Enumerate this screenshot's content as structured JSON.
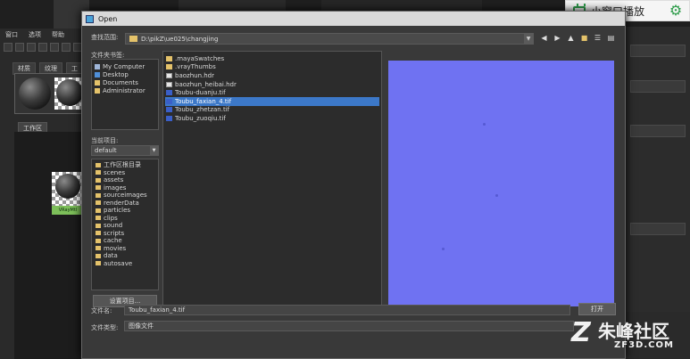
{
  "bg": {
    "menus": [
      "窗口",
      "选项",
      "帮助"
    ],
    "tabs": [
      "材质",
      "纹理",
      "工"
    ],
    "work_tab": "工作区",
    "node_label": "VRayMtl"
  },
  "mini_window": {
    "label": "小窗口播放"
  },
  "dialog": {
    "title": "Open",
    "look_in_label": "查找范围:",
    "path": "D:\\pikZ\\ue025\\changjing",
    "bookmarks_label": "文件夹书签:",
    "bookmarks": [
      "My Computer",
      "Desktop",
      "Documents",
      "Administrator"
    ],
    "project_label": "当前项目:",
    "project_value": "default",
    "project_folders": [
      "工作区根目录",
      "scenes",
      "assets",
      "images",
      "sourceimages",
      "renderData",
      "particles",
      "clips",
      "sound",
      "scripts",
      "cache",
      "movies",
      "data",
      "autosave"
    ],
    "set_project_button": "设置项目...",
    "files": [
      {
        "name": ".mayaSwatches",
        "type": "folder"
      },
      {
        "name": ".vrayThumbs",
        "type": "folder"
      },
      {
        "name": "baozhun.hdr",
        "type": "hdr"
      },
      {
        "name": "baozhun_heibai.hdr",
        "type": "hdr"
      },
      {
        "name": "Toubu-duanju.tif",
        "type": "tif"
      },
      {
        "name": "Toubu_faxian_4.tif",
        "type": "tif"
      },
      {
        "name": "Toubu_zhetzan.tif",
        "type": "tif"
      },
      {
        "name": "Toubu_zuoqiu.tif",
        "type": "tif"
      }
    ],
    "selected_index": 5,
    "preview_color": "#6f72f2",
    "filename_label": "文件名:",
    "filename_value": "Toubu_faxian_4.tif",
    "open_button": "打开",
    "filetype_label": "文件类型:",
    "filetype_value": "图像文件"
  },
  "watermark": {
    "mark": "Z",
    "name": "朱峰社区",
    "domain": "ZF3D.COM"
  }
}
